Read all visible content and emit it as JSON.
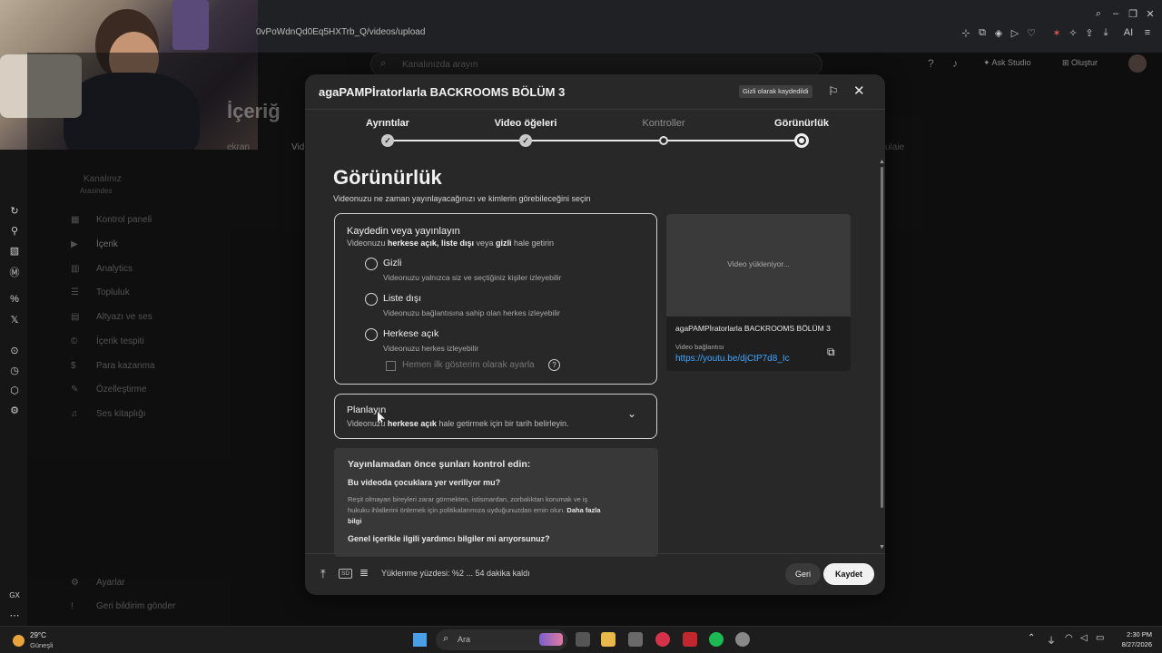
{
  "browser": {
    "url": "0vPoWdnQd0Eq5HXTrb_Q/videos/upload"
  },
  "studio_bg": {
    "search_placeholder": "Kanalınızda arayın",
    "ask_studio": "Ask Studio",
    "create": "Oluştur",
    "page_heading": "İçeriğ",
    "channel_label": "Kanalınız",
    "channel_sub": "Arasindes",
    "nav": [
      {
        "label": "Kontrol paneli"
      },
      {
        "label": "İçerik"
      },
      {
        "label": "Analytics"
      },
      {
        "label": "Topluluk"
      },
      {
        "label": "Altyazı ve ses"
      },
      {
        "label": "İçerik tespiti"
      },
      {
        "label": "Para kazanma"
      },
      {
        "label": "Özelleştirme"
      },
      {
        "label": "Ses kitaplığı"
      }
    ],
    "settings": "Ayarlar",
    "feedback": "Geri bildirim gönder",
    "tabs": [
      "ekran",
      "Vid",
      "ulaie"
    ]
  },
  "dialog": {
    "title": "agaPAMPİratorlarla BACKROOMS BÖLÜM 3",
    "badge": "Gizli olarak kaydedildi",
    "steps": [
      {
        "label": "Ayrıntılar",
        "state": "done"
      },
      {
        "label": "Video öğeleri",
        "state": "done"
      },
      {
        "label": "Kontroller",
        "state": "pending"
      },
      {
        "label": "Görünürlük",
        "state": "current"
      }
    ],
    "heading": "Görünürlük",
    "subheading": "Videonuzu ne zaman yayınlayacağınızı ve kimlerin görebileceğini seçin",
    "save_publish": {
      "title": "Kaydedin veya yayınlayın",
      "sub_prefix": "Videonuzu ",
      "sub_bold1": "herkese açık",
      "sub_sep": ", ",
      "sub_bold2": "liste dışı",
      "sub_mid": " veya ",
      "sub_bold3": "gizli",
      "sub_suffix": " hale getirin",
      "options": [
        {
          "label": "Gizli",
          "desc": "Videonuzu yalnızca siz ve seçtiğiniz kişiler izleyebilir"
        },
        {
          "label": "Liste dışı",
          "desc": "Videonuzu bağlantısına sahip olan herkes izleyebilir"
        },
        {
          "label": "Herkese açık",
          "desc": "Videonuzu herkes izleyebilir"
        }
      ],
      "premiere_label": "Hemen ilk gösterim olarak ayarla"
    },
    "schedule": {
      "title": "Planlayın",
      "sub_prefix": "Videonuzu ",
      "sub_bold": "herkese açık",
      "sub_suffix": " hale getirmek için bir tarih belirleyin."
    },
    "checklist": {
      "title": "Yayınlamadan önce şunları kontrol edin:",
      "q1": "Bu videoda çocuklara yer veriliyor mu?",
      "q1_body": "Reşit olmayan bireyleri zarar görmekten, istismardan, zorbalıktan korumak ve iş hukuku ihlallerini önlemek için politikalarımıza uyduğunuzdan emin olun.",
      "q1_link": "Daha fazla bilgi",
      "q2": "Genel içerikle ilgili yardımcı bilgiler mi arıyorsunuz?"
    },
    "preview": {
      "loading": "Video yükleniyor...",
      "title": "agaPAMPİratorlarla BACKROOMS BÖLÜM 3",
      "link_label": "Video bağlantısı",
      "link": "https://youtu.be/djCtP7d8_Ic"
    },
    "footer": {
      "sd": "SD",
      "status": "Yüklenme yüzdesi: %2 ... 54 dakika kaldı",
      "back": "Geri",
      "save": "Kaydet"
    }
  },
  "taskbar": {
    "temp": "29°C",
    "weather": "Güneşli",
    "search": "Ara",
    "time": "2:30 PM",
    "date": "8/27/2026"
  },
  "icons": {
    "close": "close-icon",
    "feedback": "feedback-icon",
    "copy": "copy-icon",
    "chevron": "chevron-down-icon"
  }
}
